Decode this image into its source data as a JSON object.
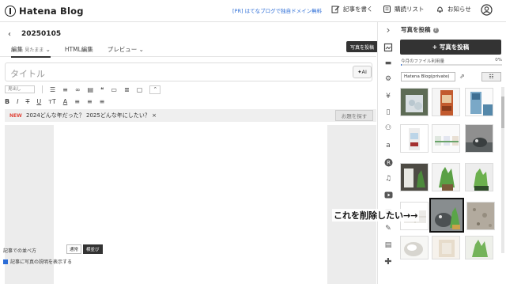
{
  "header": {
    "logo_text": "Hatena Blog",
    "promo": "[PR] はてなブログで独自ドメイン無料",
    "nav": [
      {
        "label": "記事を書く",
        "icon": "pencil-icon"
      },
      {
        "label": "購読リスト",
        "icon": "reader-icon"
      },
      {
        "label": "お知らせ",
        "icon": "bell-icon"
      }
    ],
    "avatar_icon": "user-icon"
  },
  "editor": {
    "back_icon": "chevron-left-icon",
    "entry_title": "20250105",
    "tabs": [
      {
        "label": "編集",
        "sub": "見たまま",
        "active": true
      },
      {
        "label": "HTML編集",
        "active": false
      },
      {
        "label": "プレビュー",
        "active": false
      }
    ],
    "title_placeholder": "タイトル",
    "ai_label": "AI",
    "format_select": "見出し",
    "odai": {
      "badge": "NEW",
      "text": "2024どんな年だった？ 2025どんな年にしたい？ ×",
      "button": "お題を探す"
    }
  },
  "panel": {
    "title": "写真を投稿",
    "post_button": "写真を投稿",
    "usage_label": "今月のファイル利用量",
    "usage_value": "0%",
    "album": "Hatena Blog(private)",
    "tooltip": "写真を投稿",
    "order_label": "記事での並べ方",
    "order_options": [
      {
        "label": "通常",
        "on": false
      },
      {
        "label": "横並び",
        "on": true
      }
    ],
    "check_label": "記事に写真の説明を表示する"
  },
  "annotation": "これを削除したい→→",
  "colors": {
    "accent": "#2b6cd6",
    "dark_button": "#333333",
    "new_badge": "#e0453a"
  },
  "strip_icons": [
    "chevron-right-icon",
    "photo-icon",
    "folder-icon",
    "gear-icon",
    "yen-icon",
    "document-icon",
    "people-icon",
    "amazon-icon",
    "rakuten-icon",
    "music-icon",
    "youtube-icon",
    "calendar-icon",
    "brush-icon",
    "page-icon",
    "plus-icon"
  ]
}
